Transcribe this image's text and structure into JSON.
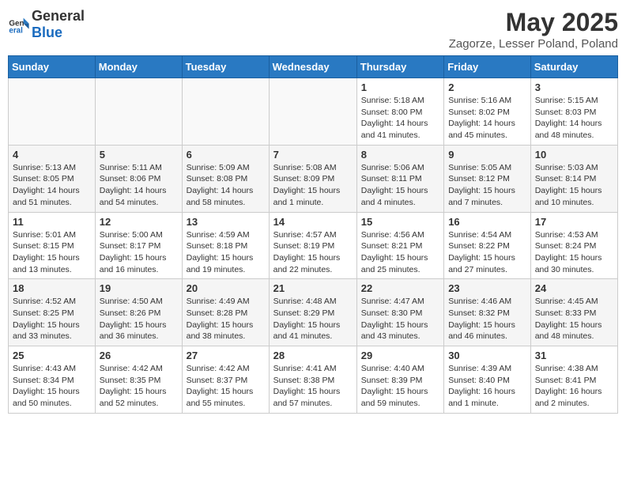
{
  "logo": {
    "general": "General",
    "blue": "Blue"
  },
  "title": "May 2025",
  "location": "Zagorze, Lesser Poland, Poland",
  "days_header": [
    "Sunday",
    "Monday",
    "Tuesday",
    "Wednesday",
    "Thursday",
    "Friday",
    "Saturday"
  ],
  "weeks": [
    [
      {
        "day": "",
        "info": ""
      },
      {
        "day": "",
        "info": ""
      },
      {
        "day": "",
        "info": ""
      },
      {
        "day": "",
        "info": ""
      },
      {
        "day": "1",
        "info": "Sunrise: 5:18 AM\nSunset: 8:00 PM\nDaylight: 14 hours and 41 minutes."
      },
      {
        "day": "2",
        "info": "Sunrise: 5:16 AM\nSunset: 8:02 PM\nDaylight: 14 hours and 45 minutes."
      },
      {
        "day": "3",
        "info": "Sunrise: 5:15 AM\nSunset: 8:03 PM\nDaylight: 14 hours and 48 minutes."
      }
    ],
    [
      {
        "day": "4",
        "info": "Sunrise: 5:13 AM\nSunset: 8:05 PM\nDaylight: 14 hours and 51 minutes."
      },
      {
        "day": "5",
        "info": "Sunrise: 5:11 AM\nSunset: 8:06 PM\nDaylight: 14 hours and 54 minutes."
      },
      {
        "day": "6",
        "info": "Sunrise: 5:09 AM\nSunset: 8:08 PM\nDaylight: 14 hours and 58 minutes."
      },
      {
        "day": "7",
        "info": "Sunrise: 5:08 AM\nSunset: 8:09 PM\nDaylight: 15 hours and 1 minute."
      },
      {
        "day": "8",
        "info": "Sunrise: 5:06 AM\nSunset: 8:11 PM\nDaylight: 15 hours and 4 minutes."
      },
      {
        "day": "9",
        "info": "Sunrise: 5:05 AM\nSunset: 8:12 PM\nDaylight: 15 hours and 7 minutes."
      },
      {
        "day": "10",
        "info": "Sunrise: 5:03 AM\nSunset: 8:14 PM\nDaylight: 15 hours and 10 minutes."
      }
    ],
    [
      {
        "day": "11",
        "info": "Sunrise: 5:01 AM\nSunset: 8:15 PM\nDaylight: 15 hours and 13 minutes."
      },
      {
        "day": "12",
        "info": "Sunrise: 5:00 AM\nSunset: 8:17 PM\nDaylight: 15 hours and 16 minutes."
      },
      {
        "day": "13",
        "info": "Sunrise: 4:59 AM\nSunset: 8:18 PM\nDaylight: 15 hours and 19 minutes."
      },
      {
        "day": "14",
        "info": "Sunrise: 4:57 AM\nSunset: 8:19 PM\nDaylight: 15 hours and 22 minutes."
      },
      {
        "day": "15",
        "info": "Sunrise: 4:56 AM\nSunset: 8:21 PM\nDaylight: 15 hours and 25 minutes."
      },
      {
        "day": "16",
        "info": "Sunrise: 4:54 AM\nSunset: 8:22 PM\nDaylight: 15 hours and 27 minutes."
      },
      {
        "day": "17",
        "info": "Sunrise: 4:53 AM\nSunset: 8:24 PM\nDaylight: 15 hours and 30 minutes."
      }
    ],
    [
      {
        "day": "18",
        "info": "Sunrise: 4:52 AM\nSunset: 8:25 PM\nDaylight: 15 hours and 33 minutes."
      },
      {
        "day": "19",
        "info": "Sunrise: 4:50 AM\nSunset: 8:26 PM\nDaylight: 15 hours and 36 minutes."
      },
      {
        "day": "20",
        "info": "Sunrise: 4:49 AM\nSunset: 8:28 PM\nDaylight: 15 hours and 38 minutes."
      },
      {
        "day": "21",
        "info": "Sunrise: 4:48 AM\nSunset: 8:29 PM\nDaylight: 15 hours and 41 minutes."
      },
      {
        "day": "22",
        "info": "Sunrise: 4:47 AM\nSunset: 8:30 PM\nDaylight: 15 hours and 43 minutes."
      },
      {
        "day": "23",
        "info": "Sunrise: 4:46 AM\nSunset: 8:32 PM\nDaylight: 15 hours and 46 minutes."
      },
      {
        "day": "24",
        "info": "Sunrise: 4:45 AM\nSunset: 8:33 PM\nDaylight: 15 hours and 48 minutes."
      }
    ],
    [
      {
        "day": "25",
        "info": "Sunrise: 4:43 AM\nSunset: 8:34 PM\nDaylight: 15 hours and 50 minutes."
      },
      {
        "day": "26",
        "info": "Sunrise: 4:42 AM\nSunset: 8:35 PM\nDaylight: 15 hours and 52 minutes."
      },
      {
        "day": "27",
        "info": "Sunrise: 4:42 AM\nSunset: 8:37 PM\nDaylight: 15 hours and 55 minutes."
      },
      {
        "day": "28",
        "info": "Sunrise: 4:41 AM\nSunset: 8:38 PM\nDaylight: 15 hours and 57 minutes."
      },
      {
        "day": "29",
        "info": "Sunrise: 4:40 AM\nSunset: 8:39 PM\nDaylight: 15 hours and 59 minutes."
      },
      {
        "day": "30",
        "info": "Sunrise: 4:39 AM\nSunset: 8:40 PM\nDaylight: 16 hours and 1 minute."
      },
      {
        "day": "31",
        "info": "Sunrise: 4:38 AM\nSunset: 8:41 PM\nDaylight: 16 hours and 2 minutes."
      }
    ]
  ]
}
